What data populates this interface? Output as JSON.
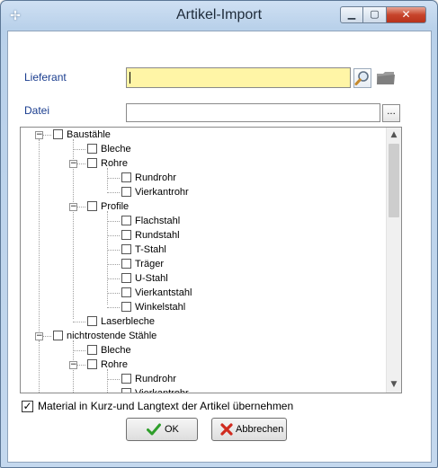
{
  "window": {
    "title": "Artikel-Import"
  },
  "form": {
    "lieferant_label": "Lieferant",
    "lieferant_value": "",
    "datei_label": "Datei",
    "datei_value": "",
    "browse_label": "..."
  },
  "tree": {
    "nodes": [
      {
        "label": "Baustähle",
        "checked": false,
        "expanded": true,
        "level": 0
      },
      {
        "label": "Bleche",
        "checked": false,
        "level": 1
      },
      {
        "label": "Rohre",
        "checked": false,
        "expanded": true,
        "level": 1
      },
      {
        "label": "Rundrohr",
        "checked": false,
        "level": 2
      },
      {
        "label": "Vierkantrohr",
        "checked": false,
        "level": 2
      },
      {
        "label": "Profile",
        "checked": false,
        "expanded": true,
        "level": 1
      },
      {
        "label": "Flachstahl",
        "checked": false,
        "level": 2
      },
      {
        "label": "Rundstahl",
        "checked": false,
        "level": 2
      },
      {
        "label": "T-Stahl",
        "checked": false,
        "level": 2
      },
      {
        "label": "Träger",
        "checked": false,
        "level": 2
      },
      {
        "label": "U-Stahl",
        "checked": false,
        "level": 2
      },
      {
        "label": "Vierkantstahl",
        "checked": false,
        "level": 2
      },
      {
        "label": "Winkelstahl",
        "checked": false,
        "level": 2
      },
      {
        "label": "Laserbleche",
        "checked": false,
        "level": 1
      },
      {
        "label": "nichtrostende Stähle",
        "checked": false,
        "expanded": true,
        "level": 0
      },
      {
        "label": "Bleche",
        "checked": false,
        "level": 1
      },
      {
        "label": "Rohre",
        "checked": false,
        "expanded": true,
        "level": 1
      },
      {
        "label": "Rundrohr",
        "checked": false,
        "level": 2
      },
      {
        "label": "Vierkantrohr",
        "checked": false,
        "level": 2
      }
    ]
  },
  "options": {
    "material_text_label": "Material in Kurz-und Langtext der Artikel übernehmen",
    "material_text_checked": true
  },
  "buttons": {
    "ok_label": "OK",
    "cancel_label": "Abbrechen"
  },
  "colors": {
    "lieferant_bg": "#fff5a6",
    "title_text": "#1e2b3a",
    "label_text": "#1a3d8f",
    "ok_icon": "#2e9e2a",
    "cancel_icon": "#d02b1f"
  }
}
